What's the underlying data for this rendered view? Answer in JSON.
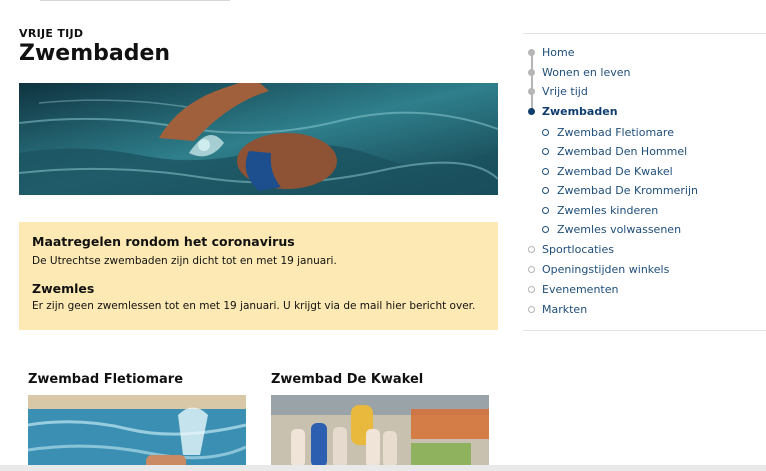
{
  "page": {
    "eyebrow": "VRIJE TIJD",
    "title": "Zwembaden"
  },
  "notice": {
    "heading1": "Maatregelen rondom het coronavirus",
    "text1": "De Utrechtse zwembaden zijn dicht tot en met 19 januari.",
    "heading2": "Zwemles",
    "text2": "Er zijn geen zwemlessen tot en met 19 januari. U krijgt via de mail hier bericht over."
  },
  "cards": [
    {
      "title": "Zwembad Fletiomare"
    },
    {
      "title": "Zwembad De Kwakel"
    }
  ],
  "sidebar": {
    "items": [
      {
        "label": "Home"
      },
      {
        "label": "Wonen en leven"
      },
      {
        "label": "Vrije tijd"
      },
      {
        "label": "Zwembaden"
      },
      {
        "label": "Zwembad Fletiomare"
      },
      {
        "label": "Zwembad Den Hommel"
      },
      {
        "label": "Zwembad De Kwakel"
      },
      {
        "label": "Zwembad De Krommerijn"
      },
      {
        "label": "Zwemles kinderen"
      },
      {
        "label": "Zwemles volwassenen"
      },
      {
        "label": "Sportlocaties"
      },
      {
        "label": "Openingstijden winkels"
      },
      {
        "label": "Evenementen"
      },
      {
        "label": "Markten"
      }
    ]
  },
  "colors": {
    "link": "#1f4e79",
    "notice_bg": "#fde9b3",
    "trail_dot": "#b5b5b5",
    "active_dot": "#0f3d6e"
  }
}
